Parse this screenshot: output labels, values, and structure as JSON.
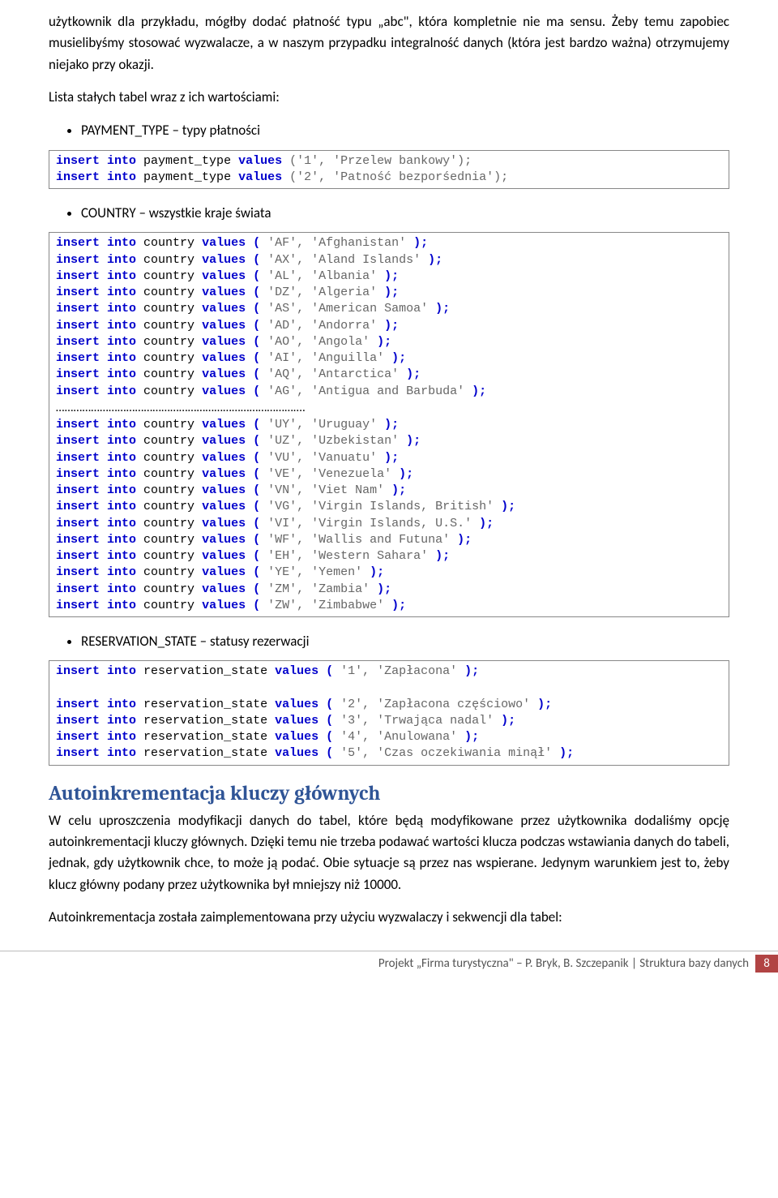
{
  "intro_para": "użytkownik dla przykładu, mógłby dodać płatność typu „abc\", która kompletnie nie ma sensu. Żeby temu zapobiec musielibyśmy stosować wyzwalacze, a w naszym przypadku integralność danych (która jest bardzo ważna) otrzymujemy niejako przy okazji.",
  "list_intro": "Lista stałych tabel wraz z ich wartościami:",
  "bullet1": "PAYMENT_TYPE – typy płatności",
  "bullet2": "COUNTRY – wszystkie kraje świata",
  "bullet3": "RESERVATION_STATE – statusy rezerwacji",
  "code1": [
    {
      "stmt": "insert into",
      "obj": "payment_type",
      "vals": "values",
      "args": "('1', 'Przelew bankowy');"
    },
    {
      "stmt": "insert into",
      "obj": "payment_type",
      "vals": "values",
      "args": "('2', 'Patność bezporśednia');"
    }
  ],
  "code2a": [
    {
      "stmt": "insert into",
      "obj": "country",
      "vals": "values (",
      "args": "'AF', 'Afghanistan'",
      "end": " );"
    },
    {
      "stmt": "insert into",
      "obj": "country",
      "vals": "values (",
      "args": "'AX', 'Aland Islands'",
      "end": " );"
    },
    {
      "stmt": "insert into",
      "obj": "country",
      "vals": "values (",
      "args": "'AL', 'Albania'",
      "end": " );"
    },
    {
      "stmt": "insert into",
      "obj": "country",
      "vals": "values (",
      "args": "'DZ', 'Algeria'",
      "end": " );"
    },
    {
      "stmt": "insert into",
      "obj": "country",
      "vals": "values (",
      "args": "'AS', 'American Samoa'",
      "end": " );"
    },
    {
      "stmt": "insert into",
      "obj": "country",
      "vals": "values (",
      "args": "'AD', 'Andorra'",
      "end": " );"
    },
    {
      "stmt": "insert into",
      "obj": "country",
      "vals": "values (",
      "args": "'AO', 'Angola'",
      "end": " );"
    },
    {
      "stmt": "insert into",
      "obj": "country",
      "vals": "values (",
      "args": "'AI', 'Anguilla'",
      "end": " );"
    },
    {
      "stmt": "insert into",
      "obj": "country",
      "vals": "values (",
      "args": "'AQ', 'Antarctica'",
      "end": " );"
    },
    {
      "stmt": "insert into",
      "obj": "country",
      "vals": "values (",
      "args": "'AG', 'Antigua and Barbuda'",
      "end": " );"
    }
  ],
  "dots": "………………………………………………………………………….",
  "code2b": [
    {
      "stmt": "insert into",
      "obj": "country",
      "vals": "values (",
      "args": "'UY', 'Uruguay'",
      "end": " );"
    },
    {
      "stmt": "insert into",
      "obj": "country",
      "vals": "values (",
      "args": "'UZ', 'Uzbekistan'",
      "end": " );"
    },
    {
      "stmt": "insert into",
      "obj": "country",
      "vals": "values (",
      "args": "'VU', 'Vanuatu'",
      "end": " );"
    },
    {
      "stmt": "insert into",
      "obj": "country",
      "vals": "values (",
      "args": "'VE', 'Venezuela'",
      "end": " );"
    },
    {
      "stmt": "insert into",
      "obj": "country",
      "vals": "values (",
      "args": "'VN', 'Viet Nam'",
      "end": " );"
    },
    {
      "stmt": "insert into",
      "obj": "country",
      "vals": "values (",
      "args": "'VG', 'Virgin Islands, British'",
      "end": " );"
    },
    {
      "stmt": "insert into",
      "obj": "country",
      "vals": "values (",
      "args": "'VI', 'Virgin Islands, U.S.'",
      "end": " );"
    },
    {
      "stmt": "insert into",
      "obj": "country",
      "vals": "values (",
      "args": "'WF', 'Wallis and Futuna'",
      "end": " );"
    },
    {
      "stmt": "insert into",
      "obj": "country",
      "vals": "values (",
      "args": "'EH', 'Western Sahara'",
      "end": " );"
    },
    {
      "stmt": "insert into",
      "obj": "country",
      "vals": "values (",
      "args": "'YE', 'Yemen'",
      "end": " );"
    },
    {
      "stmt": "insert into",
      "obj": "country",
      "vals": "values (",
      "args": "'ZM', 'Zambia'",
      "end": " );"
    },
    {
      "stmt": "insert into",
      "obj": "country",
      "vals": "values (",
      "args": "'ZW', 'Zimbabwe'",
      "end": " );"
    }
  ],
  "code3_first": {
    "stmt": "insert into",
    "obj": "reservation_state",
    "vals": "values (",
    "args": "'1', 'Zapłacona'",
    "end": " );"
  },
  "code3_rest": [
    {
      "stmt": "insert into",
      "obj": "reservation_state",
      "vals": "values (",
      "args": "'2', 'Zapłacona częściowo'",
      "end": " );"
    },
    {
      "stmt": "insert into",
      "obj": "reservation_state",
      "vals": "values (",
      "args": "'3', 'Trwająca nadal'",
      "end": " );"
    },
    {
      "stmt": "insert into",
      "obj": "reservation_state",
      "vals": "values (",
      "args": "'4', 'Anulowana'",
      "end": " );"
    },
    {
      "stmt": "insert into",
      "obj": "reservation_state",
      "vals": "values (",
      "args": "'5', 'Czas oczekiwania minął'",
      "end": " );"
    }
  ],
  "section_heading": "Autoinkrementacja kluczy głównych",
  "section_para": "W celu uproszczenia modyfikacji danych do tabel, które będą modyfikowane przez użytkownika dodaliśmy opcję autoinkrementacji kluczy głównych. Dzięki temu nie trzeba podawać wartości klucza podczas wstawiania danych do tabeli, jednak, gdy użytkownik chce, to może ją podać. Obie sytuacje są przez nas wspierane. Jedynym warunkiem jest to, żeby klucz główny podany przez użytkownika był mniejszy niż 10000.",
  "section_para2": "Autoinkrementacja została zaimplementowana przy użyciu wyzwalaczy i sekwencji dla tabel:",
  "footer_text": "Projekt „Firma turystyczna\" – P. Bryk, B. Szczepanik | Struktura bazy danych",
  "footer_page": "8"
}
